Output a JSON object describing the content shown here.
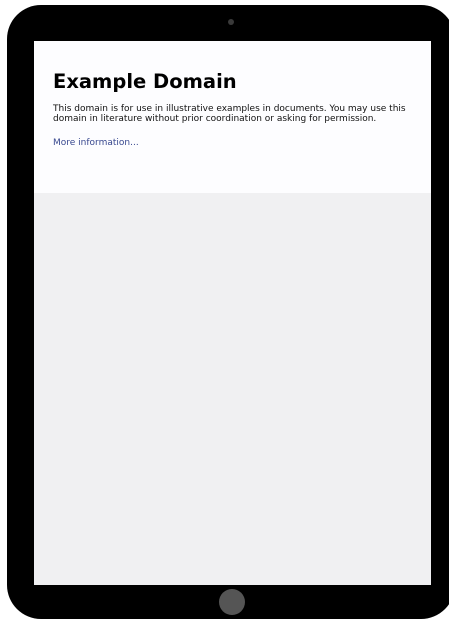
{
  "page": {
    "title": "Example Domain",
    "paragraph": "This domain is for use in illustrative examples in documents. You may use this domain in literature without prior coordination or asking for permission.",
    "link_text": "More information..."
  },
  "colors": {
    "device_frame": "#000000",
    "card_background": "#fdfdff",
    "page_background": "#f0f0f2",
    "link": "#38488f",
    "home_button": "#555555"
  },
  "icons": {
    "camera": "camera-icon",
    "home_button": "home-button-icon"
  }
}
